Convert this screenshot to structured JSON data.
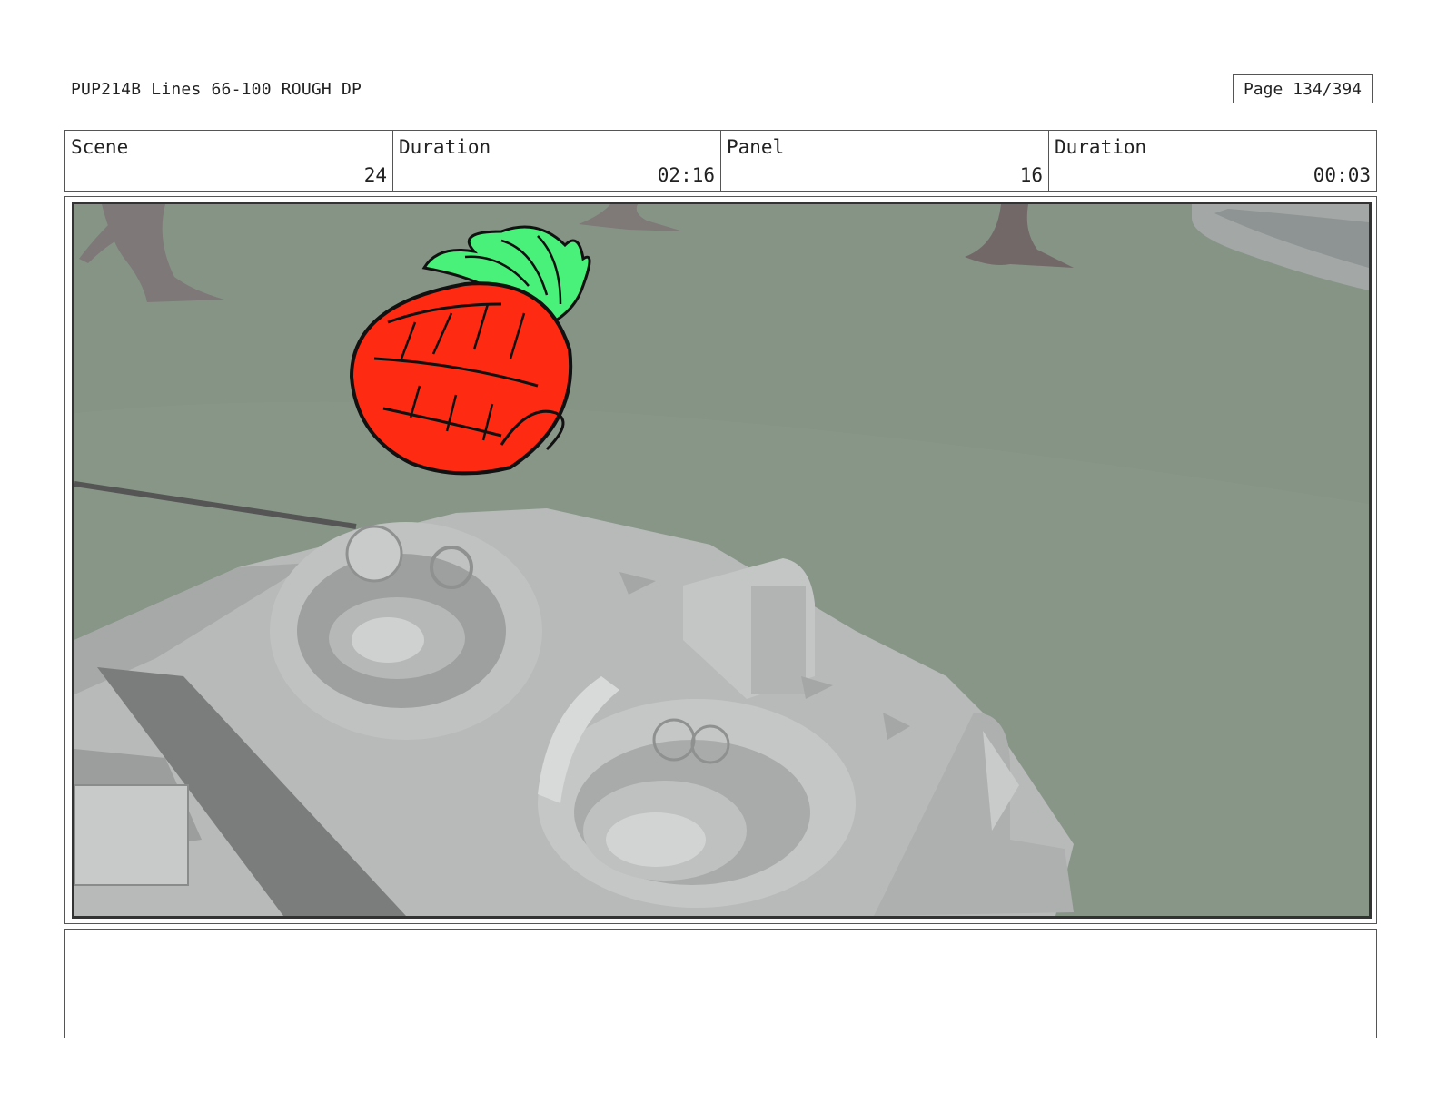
{
  "header": {
    "title": "PUP214B Lines 66-100 ROUGH DP",
    "page": "Page 134/394"
  },
  "info": {
    "scene_label": "Scene",
    "scene_value": "24",
    "scene_duration_label": "Duration",
    "scene_duration_value": "02:16",
    "panel_label": "Panel",
    "panel_value": "16",
    "panel_duration_label": "Duration",
    "panel_duration_value": "00:03"
  },
  "notes": {
    "text": ""
  },
  "colors": {
    "background": "#869486",
    "vehicle": "#b9bbbb",
    "pineapple_body": "#ff2a12",
    "pineapple_leaves": "#49f07a",
    "tree_trunk": "#7a6f6e"
  }
}
